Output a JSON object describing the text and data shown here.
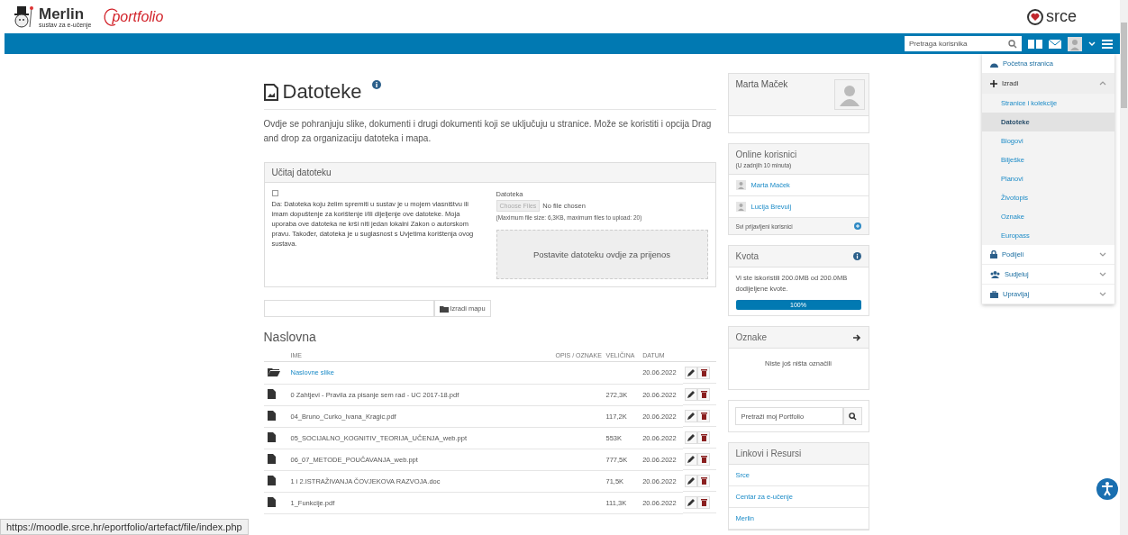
{
  "header": {
    "logo_text": "Merlin",
    "logo_subtitle": "sustav za e-učenje",
    "portfolio_logo": "portfolio",
    "partner_logo": "srce"
  },
  "navbar": {
    "search_placeholder": "Pretraga korisnika"
  },
  "menu": [
    {
      "kind": "link",
      "label": "Početna stranica"
    },
    {
      "kind": "section",
      "label": "Izradi",
      "expanded": true,
      "children": [
        {
          "label": "Stranice i kolekcije",
          "selected": false
        },
        {
          "label": "Datoteke",
          "selected": true
        },
        {
          "label": "Blogovi",
          "selected": false
        },
        {
          "label": "Bilješke",
          "selected": false
        },
        {
          "label": "Planovi",
          "selected": false
        },
        {
          "label": "Životopis",
          "selected": false
        },
        {
          "label": "Oznake",
          "selected": false
        },
        {
          "label": "Europass",
          "selected": false
        }
      ]
    },
    {
      "kind": "section",
      "label": "Podijeli",
      "expanded": false
    },
    {
      "kind": "section",
      "label": "Sudjeluj",
      "expanded": false
    },
    {
      "kind": "section",
      "label": "Upravljaj",
      "expanded": false
    }
  ],
  "page": {
    "title": "Datoteke",
    "description": "Ovdje se pohranjuju slike, dokumenti i drugi dokumenti koji se uključuju u stranice. Može se koristiti i opcija Drag and drop za organizaciju datoteka i mapa.",
    "upload": {
      "title": "Učitaj datoteku",
      "consent_checked": false,
      "consent_text": "Da: Datoteka koju želim spremiti u sustav je u mojem vlasništvu ili imam dopuštenje za korištenje i/ili dijeljenje ove datoteke. Moja uporaba ove datoteka ne krši niti jedan lokalni Zakon o autorskom pravu. Također, datoteka je u suglasnost s Uvjetima korištenja ovog sustava.",
      "file_label": "Datoteka",
      "choose_button": "Choose Files",
      "file_status": "No file chosen",
      "limits": "(Maximum file size: 6,3KB, maximum files to upload: 20)",
      "dropzone": "Postavite datoteku ovdje za prijenos"
    },
    "folder_button": "Izradi mapu",
    "section_title": "Naslovna",
    "columns": [
      "IME",
      "OPIS / OZNAKE",
      "VELIČINA",
      "DATUM"
    ],
    "rows": [
      {
        "kind": "folder",
        "name": "Naslovne slike",
        "size": "",
        "date": "20.06.2022"
      },
      {
        "kind": "file",
        "name": "0 Zahtjevi - Pravila za pisanje sem rad - UC 2017-18.pdf",
        "size": "272,3K",
        "date": "20.06.2022"
      },
      {
        "kind": "file",
        "name": "04_Bruno_Curko_Ivana_Kragic.pdf",
        "size": "117,2K",
        "date": "20.06.2022"
      },
      {
        "kind": "file",
        "name": "05_SOCIJALNO_KOGNITIV_TEORIJA_UČENJA_web.ppt",
        "size": "553K",
        "date": "20.06.2022"
      },
      {
        "kind": "file",
        "name": "06_07_METODE_POUČAVANJA_web.ppt",
        "size": "777,5K",
        "date": "20.06.2022"
      },
      {
        "kind": "file",
        "name": "1 i 2.ISTRAŽIVANJA ČOVJEKOVA RAZVOJA.doc",
        "size": "71,5K",
        "date": "20.06.2022"
      },
      {
        "kind": "file",
        "name": "1_Funkcije.pdf",
        "size": "111,3K",
        "date": "20.06.2022"
      }
    ]
  },
  "sidebar": {
    "profile": {
      "name": "Marta Maček"
    },
    "online": {
      "title": "Online korisnici",
      "subtitle": "(U zadnjih 10 minuta)",
      "users": [
        "Marta Maček",
        "Lucija Brevulj"
      ],
      "footer": "Svi prijavljeni korisnici"
    },
    "quota": {
      "title": "Kvota",
      "text": "Vi ste iskoristili 200.0MB od 200.0MB dodijeljene kvote.",
      "level": 1,
      "reading": "100%"
    },
    "tags": {
      "title": "Oznake",
      "empty": "Niste još ništa označili"
    },
    "search": {
      "placeholder": "Pretraži moj Portfolio"
    },
    "links": {
      "title": "Linkovi i Resursi",
      "items": [
        "Srce",
        "Centar za e-učenje",
        "Merlin"
      ]
    }
  },
  "status_url": "https://moodle.srce.hr/eportfolio/artefact/file/index.php"
}
